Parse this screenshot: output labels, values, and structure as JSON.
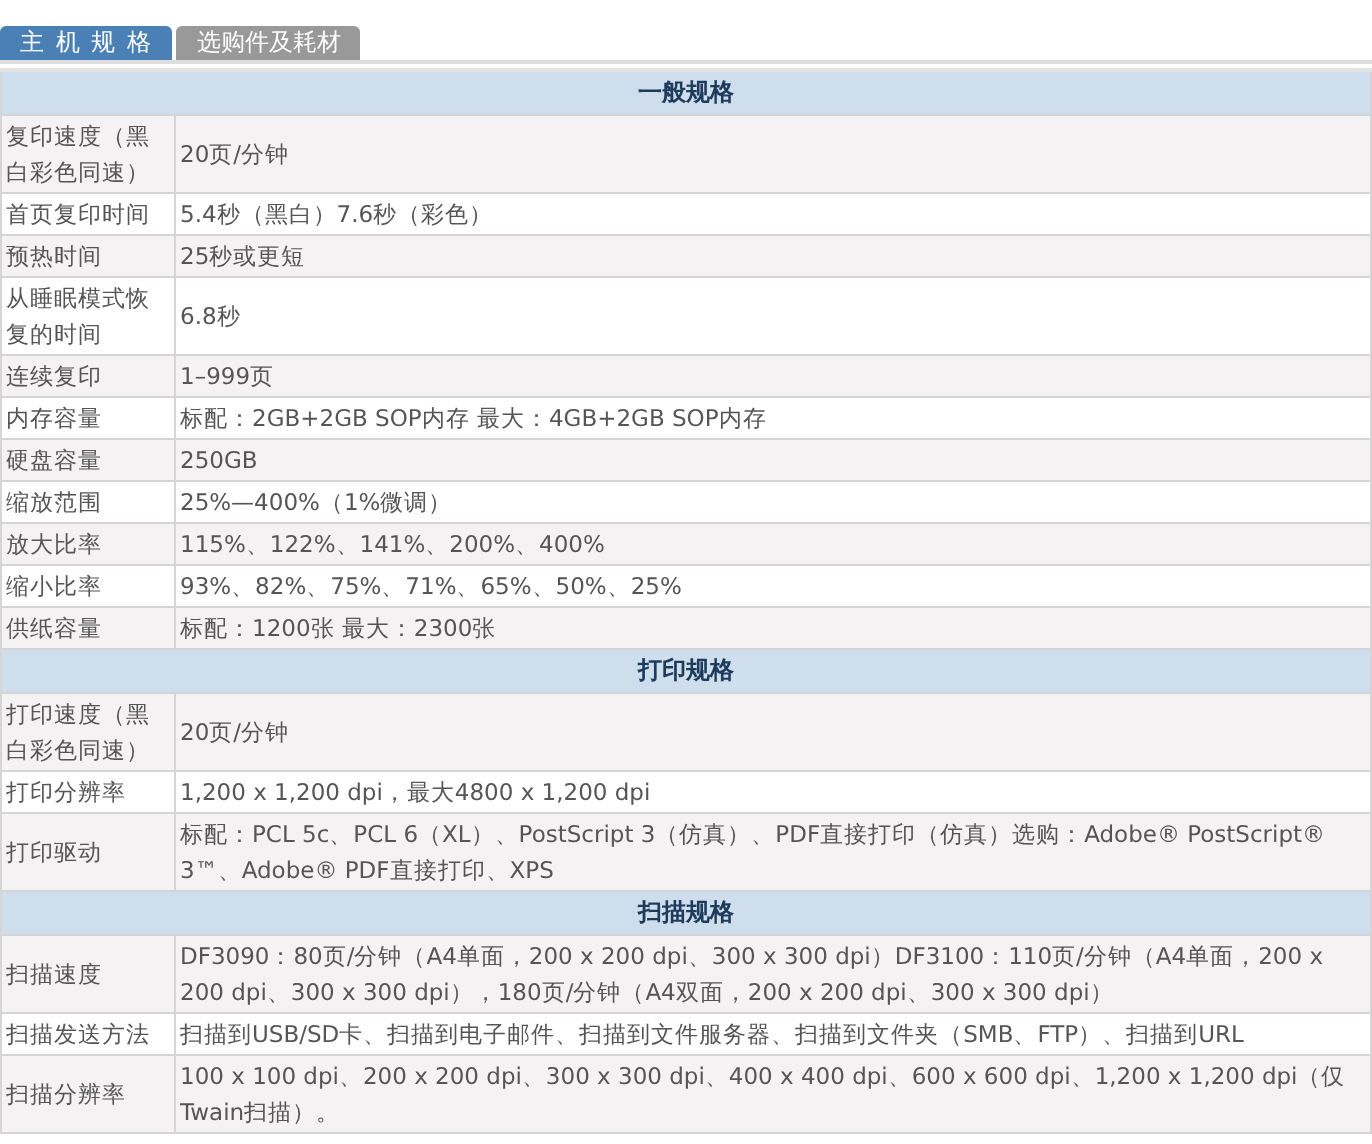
{
  "tabs": [
    {
      "label": "主 机 规 格",
      "selected": true
    },
    {
      "label": "选购件及耗材",
      "selected": false
    }
  ],
  "sections": [
    {
      "title": "一般规格",
      "rows": [
        {
          "label": "复印速度（黑白彩色同速）",
          "value": "20页/分钟"
        },
        {
          "label": "首页复印时间",
          "value": "5.4秒（黑白）7.6秒（彩色）"
        },
        {
          "label": "预热时间",
          "value": "25秒或更短"
        },
        {
          "label": "从睡眠模式恢复的时间",
          "value": "6.8秒"
        },
        {
          "label": "连续复印",
          "value": "1–999页"
        },
        {
          "label": "内存容量",
          "value": "标配：2GB+2GB SOP内存 最大：4GB+2GB SOP内存"
        },
        {
          "label": "硬盘容量",
          "value": "250GB"
        },
        {
          "label": "缩放范围",
          "value": "25%—400%（1%微调）"
        },
        {
          "label": "放大比率",
          "value": "115%、122%、141%、200%、400%"
        },
        {
          "label": "缩小比率",
          "value": "93%、82%、75%、71%、65%、50%、25%"
        },
        {
          "label": "供纸容量",
          "value": "标配：1200张 最大：2300张"
        }
      ]
    },
    {
      "title": "打印规格",
      "rows": [
        {
          "label": "打印速度（黑白彩色同速）",
          "value": "20页/分钟"
        },
        {
          "label": "打印分辨率",
          "value": "1,200 x 1,200 dpi，最大4800 x 1,200 dpi"
        },
        {
          "label": "打印驱动",
          "value": "标配：PCL 5c、PCL 6（XL）、PostScript 3（仿真）、PDF直接打印（仿真）选购：Adobe® PostScript® 3™、Adobe® PDF直接打印、XPS"
        }
      ]
    },
    {
      "title": "扫描规格",
      "rows": [
        {
          "label": "扫描速度",
          "value": "DF3090：80页/分钟（A4单面，200 x 200 dpi、300 x 300 dpi）DF3100：110页/分钟（A4单面，200 x 200 dpi、300 x 300 dpi），180页/分钟（A4双面，200 x 200 dpi、300 x 300 dpi）"
        },
        {
          "label": "扫描发送方法",
          "value": "扫描到USB/SD卡、扫描到电子邮件、扫描到文件服务器、扫描到文件夹（SMB、FTP）、扫描到URL"
        },
        {
          "label": "扫描分辨率",
          "value": "100 x 100 dpi、200 x 200 dpi、300 x 300 dpi、400 x 400 dpi、600 x 600 dpi、1,200 x 1,200 dpi（仅Twain扫描）。"
        }
      ]
    }
  ]
}
